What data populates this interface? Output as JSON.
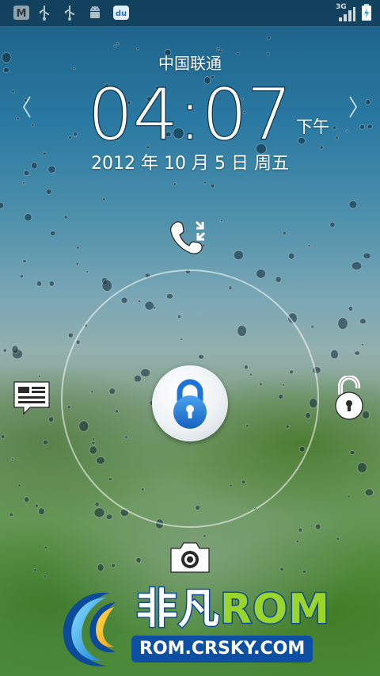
{
  "status_bar": {
    "network_type": "3G",
    "icons": [
      "app-m-icon",
      "usb-icon",
      "usb-icon",
      "android-debug-icon",
      "du-app-icon",
      "signal-icon",
      "battery-charging-icon"
    ]
  },
  "lockscreen": {
    "carrier": "中国联通",
    "time": "04:07",
    "ampm": "下午",
    "date": "2012 年 10 月 5 日 周五",
    "targets": [
      "missed-call-icon",
      "message-icon",
      "unlock-icon",
      "camera-icon"
    ]
  },
  "watermark": {
    "brand_cn": "非凡",
    "brand_rom": "ROM",
    "url": "ROM.CRSKY.COM"
  },
  "colors": {
    "accent_blue": "#1976d2",
    "brand_green": "#9bd42a",
    "brand_navy": "#0d4fa3"
  }
}
